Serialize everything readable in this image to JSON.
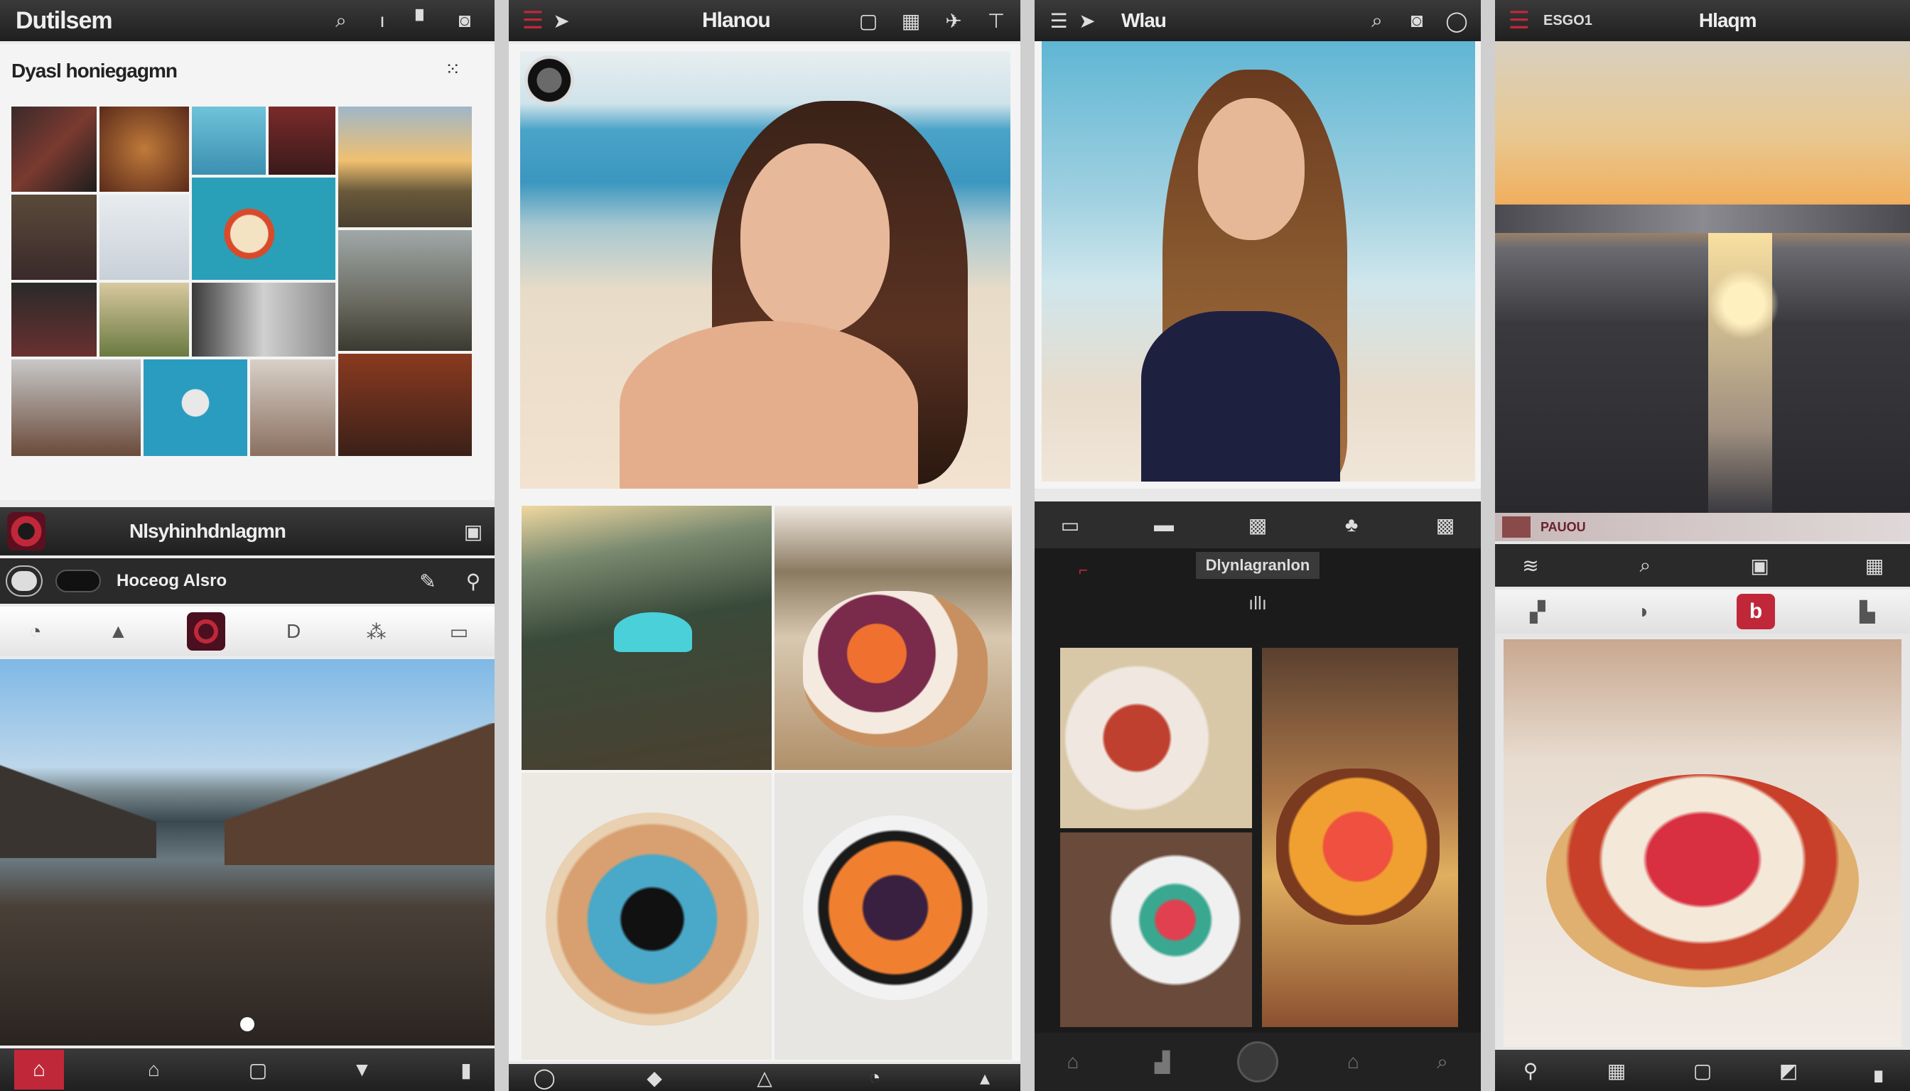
{
  "panel1": {
    "title": "Dutilsem",
    "subtitle": "Dyasl honiegagmn",
    "header2_title": "Nlsyhinhdnlagmn",
    "row_label": "Hoceog Alsro"
  },
  "panel2": {
    "title": "Hlanou"
  },
  "panel3": {
    "title": "Wlau",
    "section_label": "Dlynlagranlon"
  },
  "panel4": {
    "code": "ESGO1",
    "title": "Hlaqm",
    "strip_label": "PAUOU"
  },
  "colors": {
    "bar_dark": "#262626",
    "accent_red": "#c0283a",
    "panel_bg": "#f4f4f4"
  }
}
